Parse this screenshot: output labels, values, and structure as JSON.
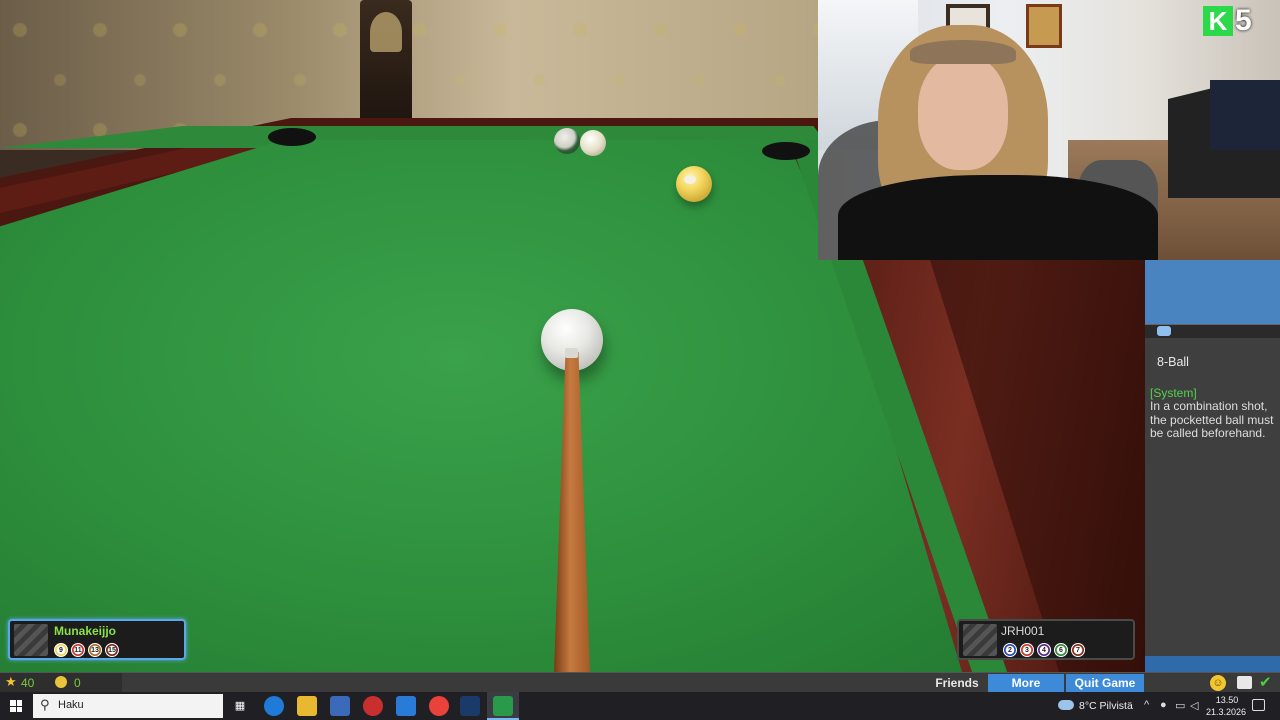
{
  "chat": {
    "title": "8-Ball",
    "system_tag": "[System]",
    "message": "In a combination shot, the pocketted ball must be called beforehand."
  },
  "players": {
    "left": {
      "name": "Munakeijjo",
      "balls": [
        "9",
        "11",
        "13",
        "15"
      ],
      "ball_colors": [
        "#f2d45a",
        "#c8372e",
        "#b06a2a",
        "#7a2a1a"
      ]
    },
    "right": {
      "name": "JRH001",
      "balls": [
        "2",
        "3",
        "4",
        "6",
        "7"
      ],
      "ball_colors": [
        "#2a4ab8",
        "#c8372e",
        "#5a2a8a",
        "#2e8a3a",
        "#8a2a1a"
      ]
    }
  },
  "stats": {
    "stars": "40",
    "coins": "0"
  },
  "gamebar": {
    "friends": "Friends",
    "more": "More",
    "quit": "Quit Game"
  },
  "webcam_overlay": {
    "logo_number": "5",
    "logo_letter": "K"
  },
  "taskbar": {
    "search_placeholder": "Haku",
    "weather": "8°C  Pilvistä",
    "time": "13.50",
    "date": "21.3.2026"
  }
}
